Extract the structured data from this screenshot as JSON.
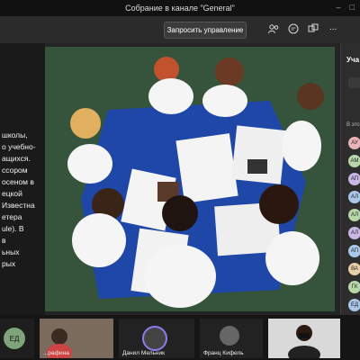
{
  "window": {
    "title": "Собрание в канале \"General\""
  },
  "toolbar": {
    "request_control_label": "Запросить управление",
    "more_label": "..."
  },
  "slide": {
    "lines": [
      "",
      "",
      "",
      "",
      "",
      "",
      "",
      "школы,",
      "о учебно-",
      "",
      "ащихся.",
      "ссором",
      "осеном в",
      "ецкой",
      "Известна",
      "етера",
      "ule). В",
      "в",
      "ьных",
      "рых"
    ]
  },
  "roster": {
    "title": "Уча",
    "subtitle": "В это",
    "avatars": [
      {
        "initials": "АУ",
        "color": "#e8b4b8"
      },
      {
        "initials": "АМ",
        "color": "#b7d7a8"
      },
      {
        "initials": "АП",
        "color": "#c9b6e4"
      },
      {
        "initials": "АЛ",
        "color": "#a9c8e8"
      },
      {
        "initials": "АЛ",
        "color": "#b7d7a8"
      },
      {
        "initials": "АЛ",
        "color": "#c9b6e4"
      },
      {
        "initials": "АП",
        "color": "#a9c8e8"
      },
      {
        "initials": "ВА",
        "color": "#e8cfa9"
      },
      {
        "initials": "ГК",
        "color": "#b7d7a8"
      },
      {
        "initials": "ЕД",
        "color": "#a9c8e8"
      }
    ]
  },
  "participants": [
    {
      "initials": "ЕД",
      "name": ""
    },
    {
      "initials": "",
      "name": "...рафина"
    },
    {
      "initials": "",
      "name": "Данил Мельник"
    },
    {
      "initials": "",
      "name": "Франц Кифель"
    },
    {
      "initials": "",
      "name": ""
    }
  ]
}
